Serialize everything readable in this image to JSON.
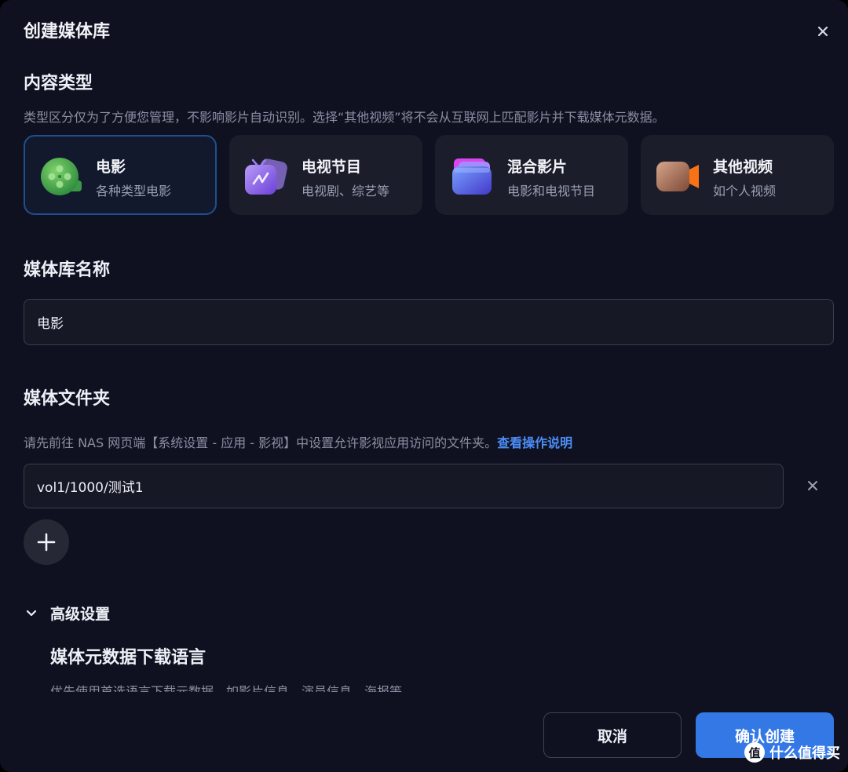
{
  "dialog": {
    "title": "创建媒体库"
  },
  "content_type": {
    "title": "内容类型",
    "description": "类型区分仅为了方便您管理，不影响影片自动识别。选择“其他视频”将不会从互联网上匹配影片并下载媒体元数据。",
    "selected": "电影",
    "options": [
      {
        "title": "电影",
        "subtitle": "各种类型电影",
        "icon": "film-reel-icon",
        "color": "#3fa34d"
      },
      {
        "title": "电视节目",
        "subtitle": "电视剧、综艺等",
        "icon": "tv-icon",
        "color": "#8b5cf6"
      },
      {
        "title": "混合影片",
        "subtitle": "电影和电视节目",
        "icon": "folder-icon",
        "color": "#4f6cf7"
      },
      {
        "title": "其他视频",
        "subtitle": "如个人视频",
        "icon": "video-camera-icon",
        "color": "#f97316"
      }
    ]
  },
  "library_name": {
    "title": "媒体库名称",
    "value": "电影"
  },
  "media_folder": {
    "title": "媒体文件夹",
    "description": "请先前往 NAS 网页端【系统设置 - 应用 - 影视】中设置允许影视应用访问的文件夹。",
    "help_link": "查看操作说明",
    "folders": [
      "vol1/1000/测试1"
    ]
  },
  "advanced": {
    "label": "高级设置",
    "expanded": true,
    "metadata_language": {
      "title": "媒体元数据下载语言",
      "description": "优先使用首选语言下载元数据，如影片信息、演员信息、海报等"
    }
  },
  "footer": {
    "cancel_label": "取消",
    "confirm_label": "确认创建"
  },
  "watermark": {
    "badge": "值",
    "text": "什么值得买"
  },
  "colors": {
    "background": "#101120",
    "card": "#1b1d2b",
    "accent": "#3478e6",
    "link": "#4c8df6"
  }
}
